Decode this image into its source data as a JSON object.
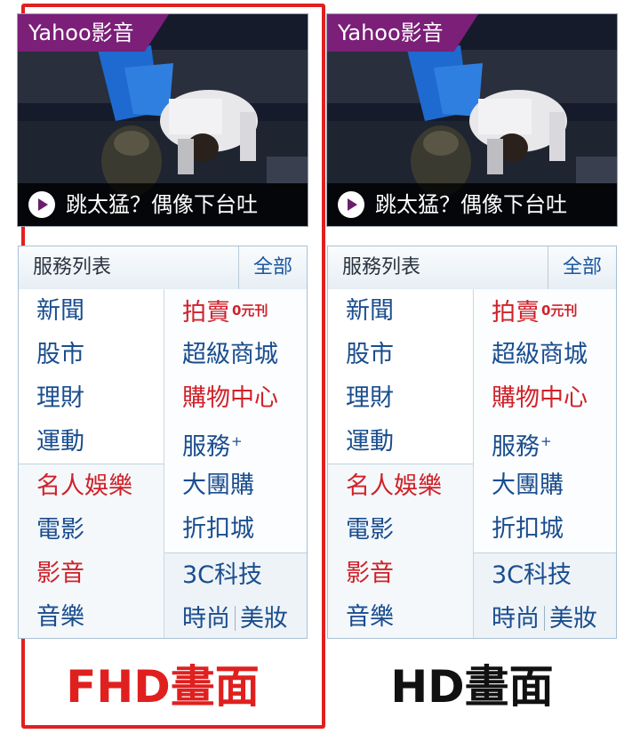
{
  "panels": [
    {
      "id": "fhd",
      "label": "FHD畫面",
      "highlighted": true,
      "video": {
        "brand": "Yahoo影音",
        "caption": "跳太猛？偶像下台吐"
      },
      "services": {
        "title": "服務列表",
        "all_link": "全部",
        "left_items": [
          "新聞",
          "股市",
          "理財",
          "運動",
          "名人娛樂",
          "電影",
          "影音",
          "音樂"
        ],
        "right_items": {
          "auction": "拍賣",
          "auction_tag": "0元刊",
          "supermall": "超級商城",
          "shopping": "購物中心",
          "service": "服務",
          "service_sup": "+",
          "group_buy": "大團購",
          "discount": "折扣城",
          "tech": "3C科技",
          "fashion": "時尚",
          "beauty": "美妝"
        }
      }
    },
    {
      "id": "hd",
      "label": "HD畫面",
      "highlighted": false,
      "video": {
        "brand": "Yahoo影音",
        "caption": "跳太猛？偶像下台吐"
      },
      "services": {
        "title": "服務列表",
        "all_link": "全部",
        "left_items": [
          "新聞",
          "股市",
          "理財",
          "運動",
          "名人娛樂",
          "電影",
          "影音",
          "音樂"
        ],
        "right_items": {
          "auction": "拍賣",
          "auction_tag": "0元刊",
          "supermall": "超級商城",
          "shopping": "購物中心",
          "service": "服務",
          "service_sup": "+",
          "group_buy": "大團購",
          "discount": "折扣城",
          "tech": "3C科技",
          "fashion": "時尚",
          "beauty": "美妝"
        }
      }
    }
  ],
  "colors": {
    "highlight": "#e0201f",
    "brand_purple": "#7b1f78",
    "link_blue": "#1a4d8e",
    "link_red": "#d0222a"
  }
}
